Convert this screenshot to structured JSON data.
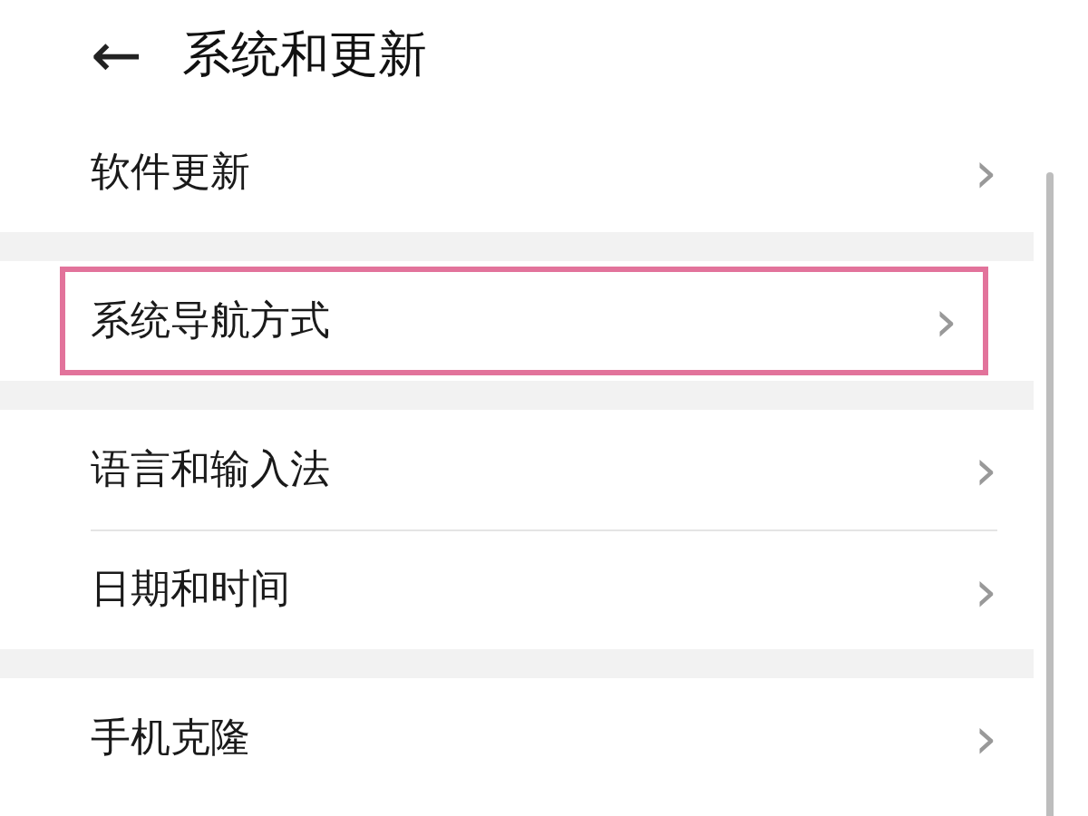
{
  "header": {
    "back": "←",
    "title": "系统和更新"
  },
  "groups": [
    {
      "items": [
        {
          "label": "软件更新",
          "chevron": "›",
          "highlighted": false
        }
      ]
    },
    {
      "items": [
        {
          "label": "系统导航方式",
          "chevron": "›",
          "highlighted": true
        }
      ]
    },
    {
      "items": [
        {
          "label": "语言和输入法",
          "chevron": "›",
          "highlighted": false
        },
        {
          "label": "日期和时间",
          "chevron": "›",
          "highlighted": false
        }
      ]
    },
    {
      "items": [
        {
          "label": "手机克隆",
          "chevron": "›",
          "highlighted": false
        }
      ]
    }
  ]
}
